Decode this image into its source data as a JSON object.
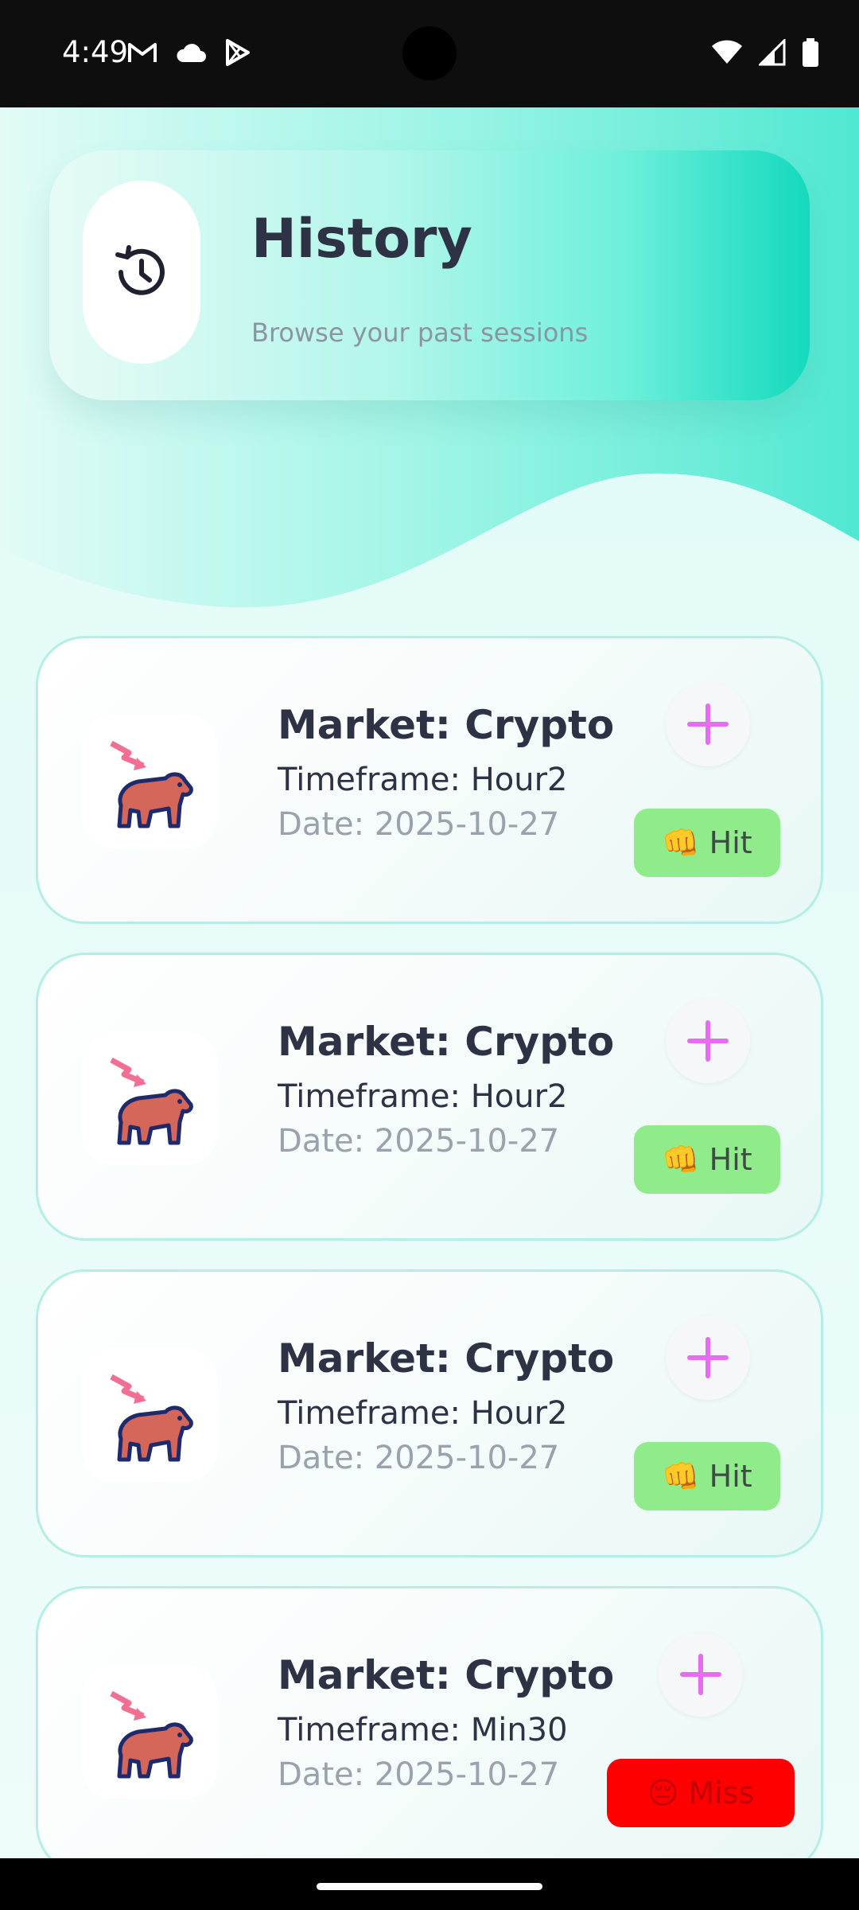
{
  "status_bar": {
    "time": "4:49",
    "icons_left": [
      "gmail-icon",
      "cloud-icon",
      "play-store-icon"
    ],
    "icons_right": [
      "wifi-icon",
      "signal-icon",
      "battery-icon"
    ]
  },
  "header": {
    "title": "History",
    "subtitle": "Browse your past sessions",
    "icon": "history-icon"
  },
  "colors": {
    "accent": "#14d9bd",
    "hit_badge": "#90ec8a",
    "miss_badge": "#ff0000",
    "plus": "#e66cf2",
    "title_text": "#2e3245"
  },
  "sessions": [
    {
      "market": "Market: Crypto",
      "timeframe": "Timeframe: Hour2",
      "date": "Date: 2025-10-27",
      "result_emoji": "👊",
      "result_label": "Hit",
      "result_type": "hit",
      "icon": "bear-market-icon"
    },
    {
      "market": "Market: Crypto",
      "timeframe": "Timeframe: Hour2",
      "date": "Date: 2025-10-27",
      "result_emoji": "👊",
      "result_label": "Hit",
      "result_type": "hit",
      "icon": "bear-market-icon"
    },
    {
      "market": "Market: Crypto",
      "timeframe": "Timeframe: Hour2",
      "date": "Date: 2025-10-27",
      "result_emoji": "👊",
      "result_label": "Hit",
      "result_type": "hit",
      "icon": "bear-market-icon"
    },
    {
      "market": "Market: Crypto",
      "timeframe": "Timeframe: Min30",
      "date": "Date: 2025-10-27",
      "result_emoji": "😔",
      "result_label": "Miss",
      "result_type": "miss",
      "icon": "bear-market-icon"
    }
  ]
}
